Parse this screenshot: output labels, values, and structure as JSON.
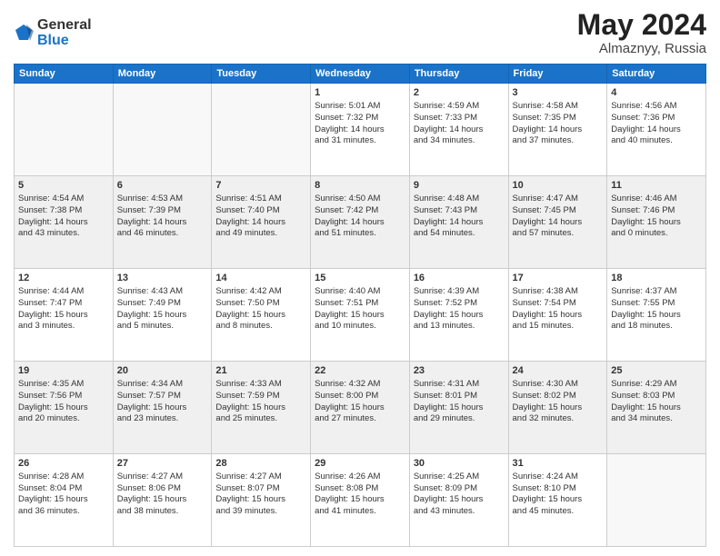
{
  "logo": {
    "general": "General",
    "blue": "Blue"
  },
  "title": "May 2024",
  "subtitle": "Almaznyy, Russia",
  "days": [
    "Sunday",
    "Monday",
    "Tuesday",
    "Wednesday",
    "Thursday",
    "Friday",
    "Saturday"
  ],
  "weeks": [
    [
      {
        "day": "",
        "info": ""
      },
      {
        "day": "",
        "info": ""
      },
      {
        "day": "",
        "info": ""
      },
      {
        "day": "1",
        "info": "Sunrise: 5:01 AM\nSunset: 7:32 PM\nDaylight: 14 hours\nand 31 minutes."
      },
      {
        "day": "2",
        "info": "Sunrise: 4:59 AM\nSunset: 7:33 PM\nDaylight: 14 hours\nand 34 minutes."
      },
      {
        "day": "3",
        "info": "Sunrise: 4:58 AM\nSunset: 7:35 PM\nDaylight: 14 hours\nand 37 minutes."
      },
      {
        "day": "4",
        "info": "Sunrise: 4:56 AM\nSunset: 7:36 PM\nDaylight: 14 hours\nand 40 minutes."
      }
    ],
    [
      {
        "day": "5",
        "info": "Sunrise: 4:54 AM\nSunset: 7:38 PM\nDaylight: 14 hours\nand 43 minutes."
      },
      {
        "day": "6",
        "info": "Sunrise: 4:53 AM\nSunset: 7:39 PM\nDaylight: 14 hours\nand 46 minutes."
      },
      {
        "day": "7",
        "info": "Sunrise: 4:51 AM\nSunset: 7:40 PM\nDaylight: 14 hours\nand 49 minutes."
      },
      {
        "day": "8",
        "info": "Sunrise: 4:50 AM\nSunset: 7:42 PM\nDaylight: 14 hours\nand 51 minutes."
      },
      {
        "day": "9",
        "info": "Sunrise: 4:48 AM\nSunset: 7:43 PM\nDaylight: 14 hours\nand 54 minutes."
      },
      {
        "day": "10",
        "info": "Sunrise: 4:47 AM\nSunset: 7:45 PM\nDaylight: 14 hours\nand 57 minutes."
      },
      {
        "day": "11",
        "info": "Sunrise: 4:46 AM\nSunset: 7:46 PM\nDaylight: 15 hours\nand 0 minutes."
      }
    ],
    [
      {
        "day": "12",
        "info": "Sunrise: 4:44 AM\nSunset: 7:47 PM\nDaylight: 15 hours\nand 3 minutes."
      },
      {
        "day": "13",
        "info": "Sunrise: 4:43 AM\nSunset: 7:49 PM\nDaylight: 15 hours\nand 5 minutes."
      },
      {
        "day": "14",
        "info": "Sunrise: 4:42 AM\nSunset: 7:50 PM\nDaylight: 15 hours\nand 8 minutes."
      },
      {
        "day": "15",
        "info": "Sunrise: 4:40 AM\nSunset: 7:51 PM\nDaylight: 15 hours\nand 10 minutes."
      },
      {
        "day": "16",
        "info": "Sunrise: 4:39 AM\nSunset: 7:52 PM\nDaylight: 15 hours\nand 13 minutes."
      },
      {
        "day": "17",
        "info": "Sunrise: 4:38 AM\nSunset: 7:54 PM\nDaylight: 15 hours\nand 15 minutes."
      },
      {
        "day": "18",
        "info": "Sunrise: 4:37 AM\nSunset: 7:55 PM\nDaylight: 15 hours\nand 18 minutes."
      }
    ],
    [
      {
        "day": "19",
        "info": "Sunrise: 4:35 AM\nSunset: 7:56 PM\nDaylight: 15 hours\nand 20 minutes."
      },
      {
        "day": "20",
        "info": "Sunrise: 4:34 AM\nSunset: 7:57 PM\nDaylight: 15 hours\nand 23 minutes."
      },
      {
        "day": "21",
        "info": "Sunrise: 4:33 AM\nSunset: 7:59 PM\nDaylight: 15 hours\nand 25 minutes."
      },
      {
        "day": "22",
        "info": "Sunrise: 4:32 AM\nSunset: 8:00 PM\nDaylight: 15 hours\nand 27 minutes."
      },
      {
        "day": "23",
        "info": "Sunrise: 4:31 AM\nSunset: 8:01 PM\nDaylight: 15 hours\nand 29 minutes."
      },
      {
        "day": "24",
        "info": "Sunrise: 4:30 AM\nSunset: 8:02 PM\nDaylight: 15 hours\nand 32 minutes."
      },
      {
        "day": "25",
        "info": "Sunrise: 4:29 AM\nSunset: 8:03 PM\nDaylight: 15 hours\nand 34 minutes."
      }
    ],
    [
      {
        "day": "26",
        "info": "Sunrise: 4:28 AM\nSunset: 8:04 PM\nDaylight: 15 hours\nand 36 minutes."
      },
      {
        "day": "27",
        "info": "Sunrise: 4:27 AM\nSunset: 8:06 PM\nDaylight: 15 hours\nand 38 minutes."
      },
      {
        "day": "28",
        "info": "Sunrise: 4:27 AM\nSunset: 8:07 PM\nDaylight: 15 hours\nand 39 minutes."
      },
      {
        "day": "29",
        "info": "Sunrise: 4:26 AM\nSunset: 8:08 PM\nDaylight: 15 hours\nand 41 minutes."
      },
      {
        "day": "30",
        "info": "Sunrise: 4:25 AM\nSunset: 8:09 PM\nDaylight: 15 hours\nand 43 minutes."
      },
      {
        "day": "31",
        "info": "Sunrise: 4:24 AM\nSunset: 8:10 PM\nDaylight: 15 hours\nand 45 minutes."
      },
      {
        "day": "",
        "info": ""
      }
    ]
  ]
}
